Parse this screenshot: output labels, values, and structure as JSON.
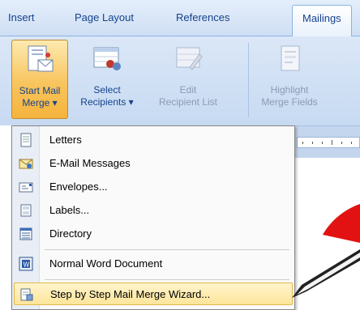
{
  "tabs": [
    {
      "label": "Insert",
      "active": false
    },
    {
      "label": "Page Layout",
      "active": false
    },
    {
      "label": "References",
      "active": false
    },
    {
      "label": "Mailings",
      "active": true
    }
  ],
  "ribbon": {
    "start_mail_merge": {
      "line1": "Start Mail",
      "line2": "Merge ▾",
      "icon": "start-mail-merge-icon"
    },
    "select_recipients": {
      "line1": "Select",
      "line2": "Recipients ▾",
      "icon": "select-recipients-icon"
    },
    "edit_recipient_list": {
      "line1": "Edit",
      "line2": "Recipient List",
      "icon": "edit-recipient-list-icon",
      "disabled": true
    },
    "highlight_merge_fields": {
      "line1": "Highlight",
      "line2": "Merge Fields",
      "icon": "highlight-merge-fields-icon",
      "disabled": true
    }
  },
  "menu": {
    "items": [
      {
        "label": "Letters",
        "icon": "letter-icon"
      },
      {
        "label": "E-Mail Messages",
        "icon": "email-icon"
      },
      {
        "label": "Envelopes...",
        "icon": "envelope-icon"
      },
      {
        "label": "Labels...",
        "icon": "labels-icon"
      },
      {
        "label": "Directory",
        "icon": "directory-icon"
      },
      {
        "label": "Normal Word Document",
        "icon": "word-document-icon"
      },
      {
        "label": "Step by Step Mail Merge Wizard...",
        "icon": "wizard-icon",
        "selected": true
      }
    ]
  },
  "colors": {
    "accent": "#15428b",
    "highlight": "#fde59a",
    "callout": "#e31212"
  }
}
